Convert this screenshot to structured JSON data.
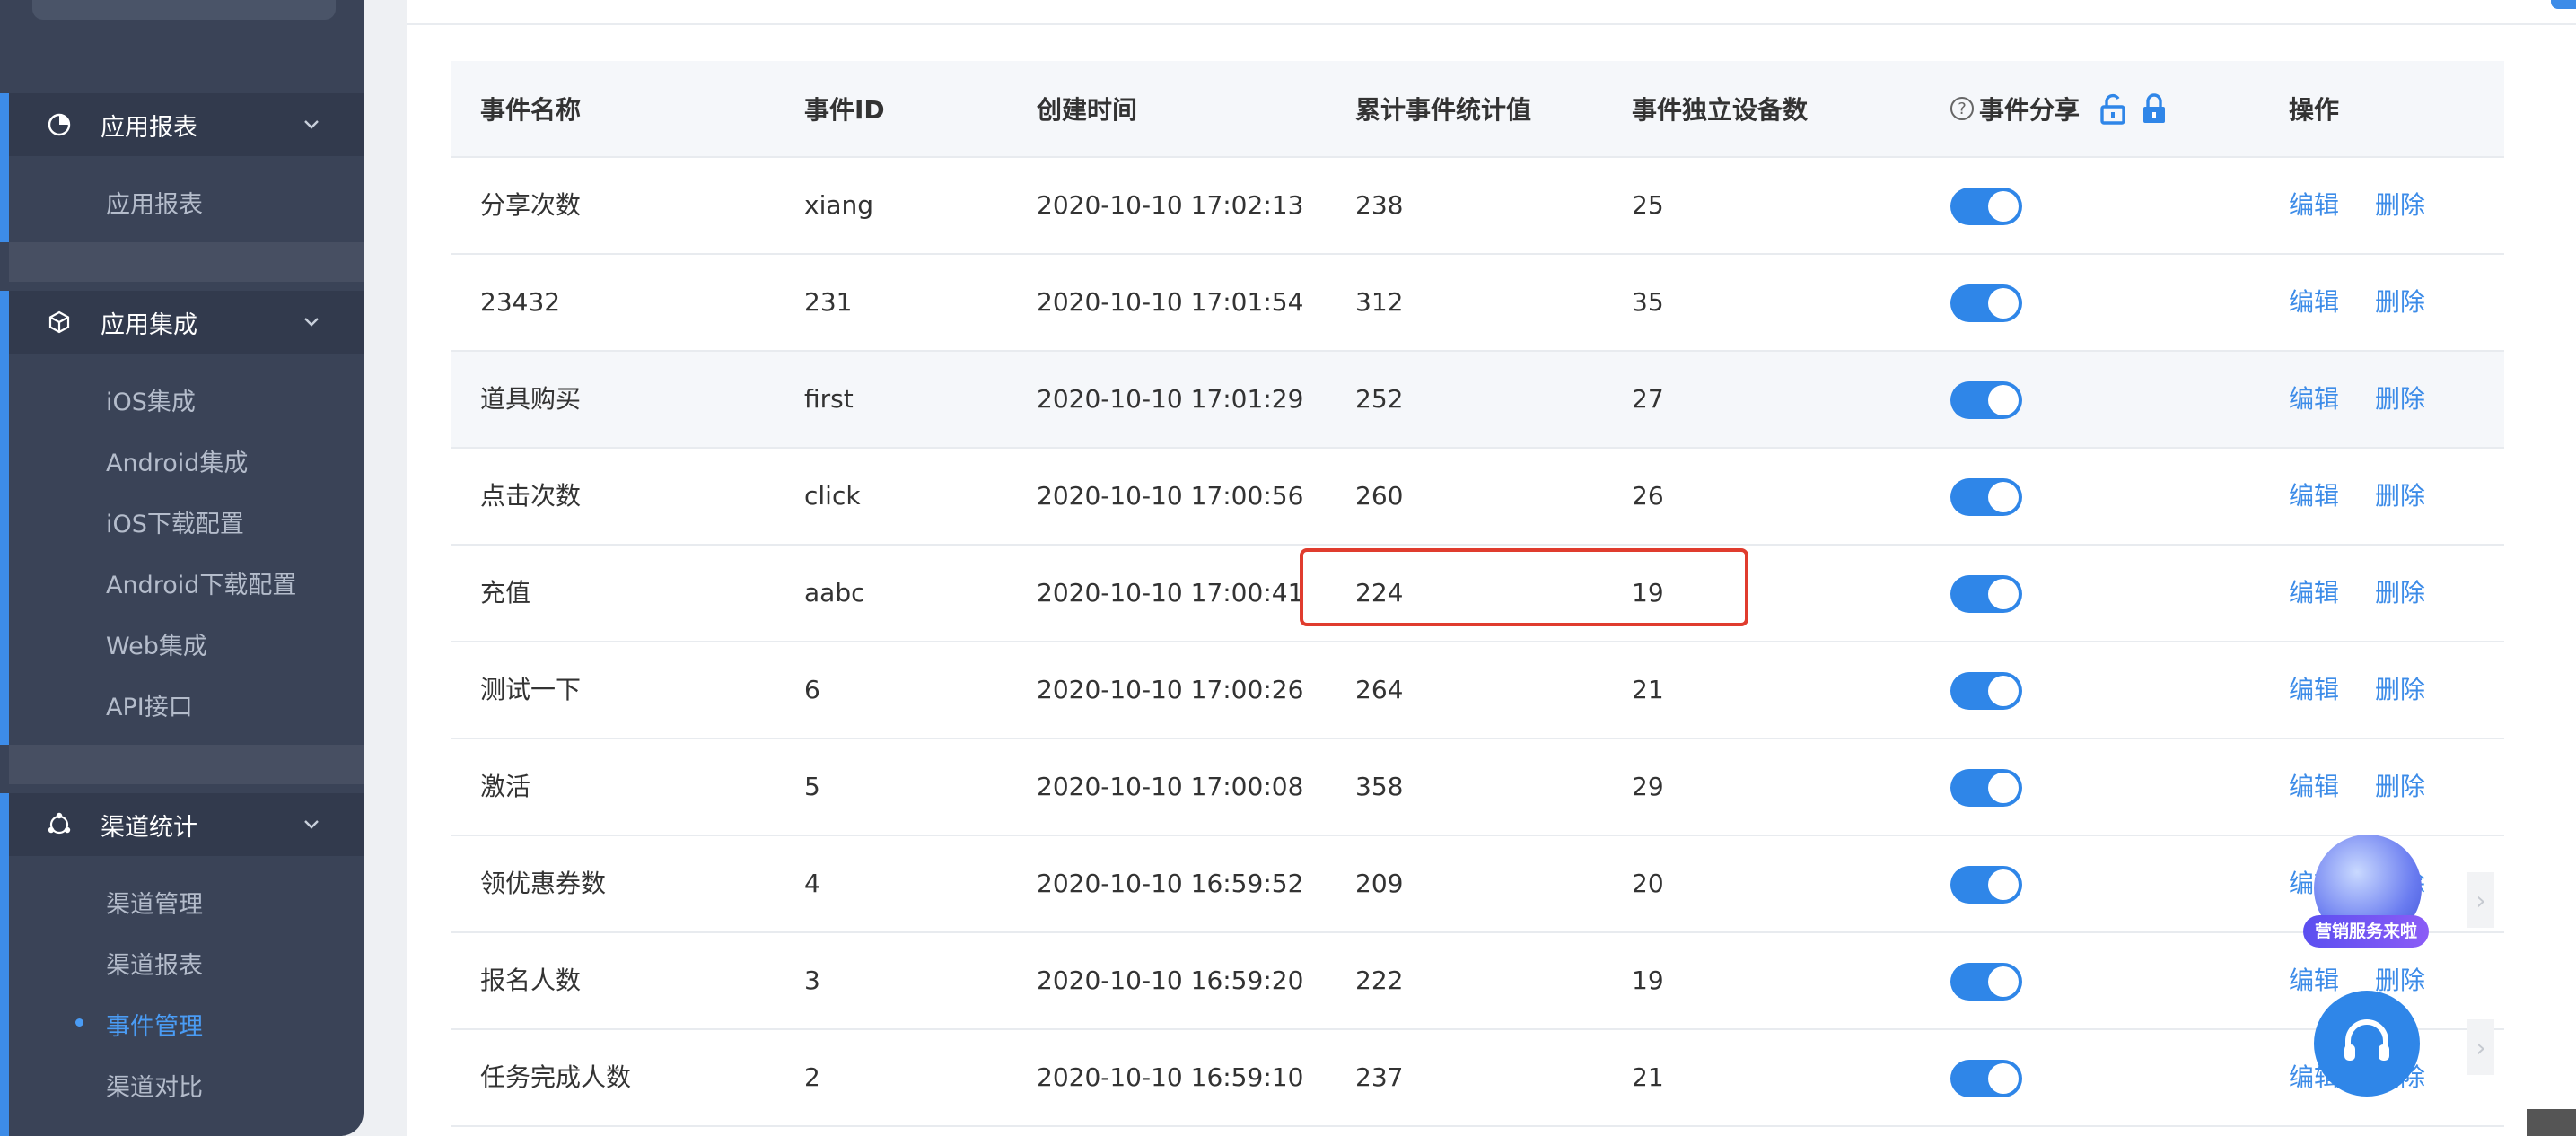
{
  "sidebar": {
    "groups": [
      {
        "label": "应用报表",
        "icon": "pie-chart-icon",
        "items": [
          "应用报表"
        ]
      },
      {
        "label": "应用集成",
        "icon": "cube-icon",
        "items": [
          "iOS集成",
          "Android集成",
          "iOS下载配置",
          "Android下载配置",
          "Web集成",
          "API接口"
        ]
      },
      {
        "label": "渠道统计",
        "icon": "channel-icon",
        "items": [
          "渠道管理",
          "渠道报表",
          "事件管理",
          "渠道对比"
        ]
      }
    ],
    "active_item": "事件管理"
  },
  "table": {
    "headers": [
      "事件名称",
      "事件ID",
      "创建时间",
      "累计事件统计值",
      "事件独立设备数",
      "事件分享",
      "操作"
    ],
    "rows": [
      {
        "name": "分享次数",
        "id": "xiang",
        "time": "2020-10-10 17:02:13",
        "total": "238",
        "devices": "25",
        "share": true
      },
      {
        "name": "23432",
        "id": "231",
        "time": "2020-10-10 17:01:54",
        "total": "312",
        "devices": "35",
        "share": true
      },
      {
        "name": "道具购买",
        "id": "first",
        "time": "2020-10-10 17:01:29",
        "total": "252",
        "devices": "27",
        "share": true
      },
      {
        "name": "点击次数",
        "id": "click",
        "time": "2020-10-10 17:00:56",
        "total": "260",
        "devices": "26",
        "share": true
      },
      {
        "name": "充值",
        "id": "aabc",
        "time": "2020-10-10 17:00:41",
        "total": "224",
        "devices": "19",
        "share": true
      },
      {
        "name": "测试一下",
        "id": "6",
        "time": "2020-10-10 17:00:26",
        "total": "264",
        "devices": "21",
        "share": true
      },
      {
        "name": "激活",
        "id": "5",
        "time": "2020-10-10 17:00:08",
        "total": "358",
        "devices": "29",
        "share": true
      },
      {
        "name": "领优惠券数",
        "id": "4",
        "time": "2020-10-10 16:59:52",
        "total": "209",
        "devices": "20",
        "share": true
      },
      {
        "name": "报名人数",
        "id": "3",
        "time": "2020-10-10 16:59:20",
        "total": "222",
        "devices": "19",
        "share": true
      },
      {
        "name": "任务完成人数",
        "id": "2",
        "time": "2020-10-10 16:59:10",
        "total": "237",
        "devices": "21",
        "share": true
      }
    ],
    "actions": {
      "edit": "编辑",
      "delete": "删除"
    }
  },
  "promo": {
    "badge": "营销服务来啦"
  },
  "colors": {
    "accent": "#2f86e8",
    "sidebar_bg": "#3a4357",
    "highlight": "#e03c2e"
  }
}
